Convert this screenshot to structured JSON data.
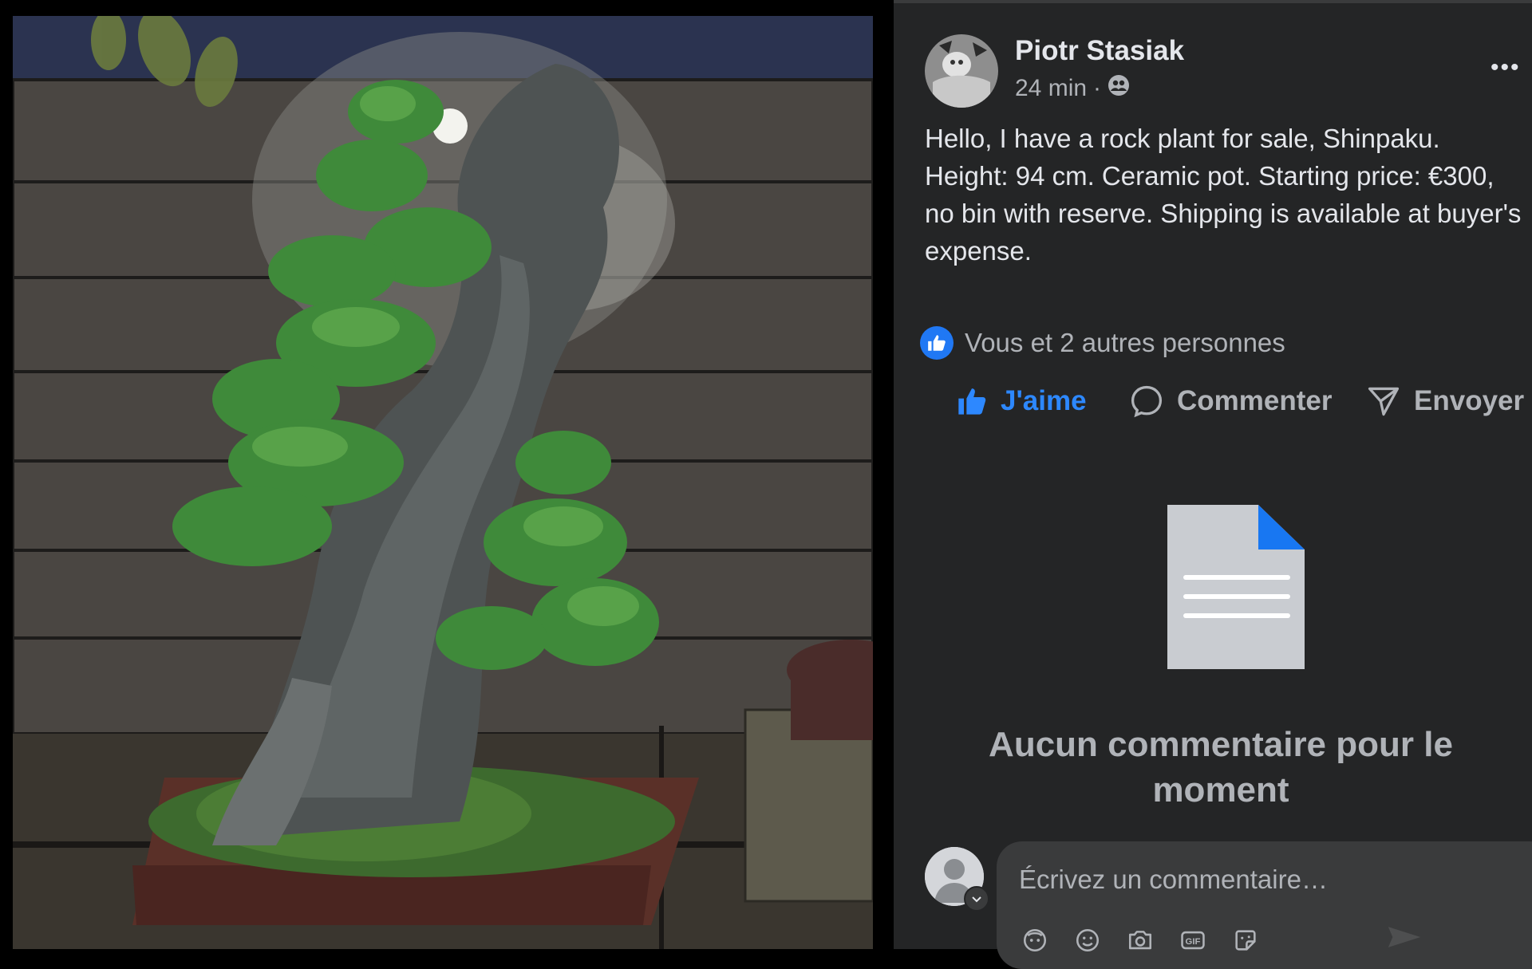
{
  "photo": {
    "description_icon": "bonsai-photo"
  },
  "post": {
    "author": "Piotr Stasiak",
    "time": "24 min",
    "separator": "·",
    "audience_icon": "friends-icon",
    "more_label": "•••",
    "text": "Hello, I have a rock plant for sale, Shinpaku. Height: 94 cm. Ceramic pot. Starting price: €300, no bin with reserve. Shipping is available at buyer's expense.",
    "reactions_text": "Vous et 2 autres personnes"
  },
  "actions": {
    "like": "J'aime",
    "comment": "Commenter",
    "send": "Envoyer"
  },
  "comments": {
    "empty_title": "Aucun commentaire pour le moment",
    "placeholder": "Écrivez un commentaire…",
    "tools": [
      "avatar-sticker-icon",
      "emoji-icon",
      "camera-icon",
      "gif-icon",
      "sticker-icon"
    ],
    "gif_label": "GIF"
  },
  "colors": {
    "background": "#242526",
    "text": "#e4e6eb",
    "secondary": "#b0b3b8",
    "accent": "#2d88ff",
    "input_bg": "#3a3b3c"
  }
}
